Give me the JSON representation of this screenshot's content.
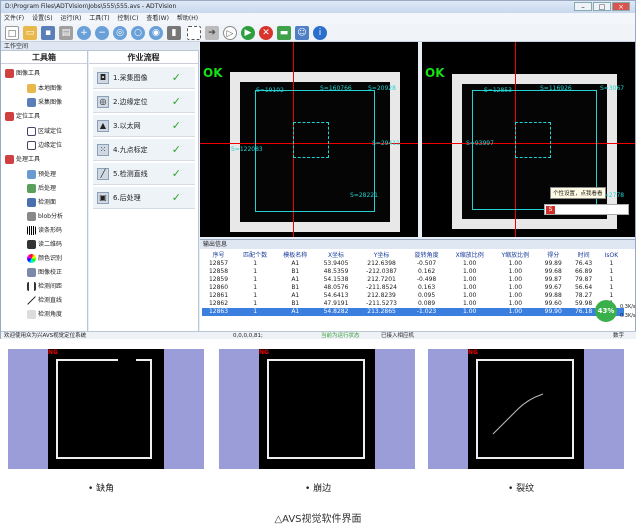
{
  "window": {
    "title": "D:\\Program Files\\ADTVision\\Jobs\\555\\555.avs - ADTVision"
  },
  "menu": [
    "文件(F)",
    "设置(S)",
    "运行(R)",
    "工具(T)",
    "控制(C)",
    "查看(W)",
    "帮助(H)"
  ],
  "panel_title": "工作空间",
  "toolbox": {
    "title": "工具箱",
    "items": [
      {
        "label": "图像工具",
        "level": 0
      },
      {
        "label": "本地图像",
        "level": 1
      },
      {
        "label": "采集图像",
        "level": 1
      },
      {
        "label": "定位工具",
        "level": 0
      },
      {
        "label": "区域定位",
        "level": 1
      },
      {
        "label": "边缘定位",
        "level": 1
      },
      {
        "label": "处理工具",
        "level": 0
      },
      {
        "label": "预处理",
        "level": 1
      },
      {
        "label": "后处理",
        "level": 1
      },
      {
        "label": "检测面",
        "level": 1
      },
      {
        "label": "blob分析",
        "level": 1
      },
      {
        "label": "读条形码",
        "level": 1
      },
      {
        "label": "读二维码",
        "level": 1
      },
      {
        "label": "颜色识别",
        "level": 1
      },
      {
        "label": "图像校正",
        "level": 1
      },
      {
        "label": "检测间距",
        "level": 1
      },
      {
        "label": "检测直线",
        "level": 1
      },
      {
        "label": "检测角度",
        "level": 1
      }
    ]
  },
  "workflow": {
    "title": "作业流程",
    "steps": [
      {
        "label": "1.采集图像",
        "icon": "camera-icon",
        "done": "✓"
      },
      {
        "label": "2.边缘定位",
        "icon": "target-icon",
        "done": "✓"
      },
      {
        "label": "3.以太网",
        "icon": "network-icon",
        "done": "✓"
      },
      {
        "label": "4.九点标定",
        "icon": "grid-icon",
        "done": "✓"
      },
      {
        "label": "5.检测直线",
        "icon": "line-icon",
        "done": "✓"
      },
      {
        "label": "6.后处理",
        "icon": "process-icon",
        "done": "✓"
      }
    ]
  },
  "views": {
    "left": {
      "status": "OK",
      "s_top": "S=19102",
      "s_top2": "S=160766",
      "s_right": "S=20928",
      "s_mid": "S=29411",
      "s_left": "S=122083",
      "s_bot": "S=28221"
    },
    "right": {
      "status": "OK",
      "s_top": "S=12853",
      "s_top2": "S=116926",
      "s_right": "S=3067",
      "s_left": "S=93997",
      "s_right2": "S=2778"
    }
  },
  "tooltip": "个性设置，点我看看",
  "output": {
    "title": "输出信息",
    "columns": [
      "序号",
      "匹配个数",
      "模板名称",
      "X坐标",
      "Y坐标",
      "旋转角度",
      "X缩放比例",
      "Y缩放比例",
      "得分",
      "时间",
      "IsOK"
    ],
    "rows": [
      [
        "12857",
        "1",
        "A1",
        "53.9405",
        "212.6398",
        "-0.507",
        "1.00",
        "1.00",
        "99.89",
        "76.43",
        "1"
      ],
      [
        "12858",
        "1",
        "B1",
        "48.5359",
        "-212.0387",
        "0.162",
        "1.00",
        "1.00",
        "99.68",
        "66.89",
        "1"
      ],
      [
        "12859",
        "1",
        "A1",
        "54.1538",
        "212.7201",
        "-0.498",
        "1.00",
        "1.00",
        "99.87",
        "79.87",
        "1"
      ],
      [
        "12860",
        "1",
        "B1",
        "48.0576",
        "-211.8524",
        "0.163",
        "1.00",
        "1.00",
        "99.67",
        "56.64",
        "1"
      ],
      [
        "12861",
        "1",
        "A1",
        "54.6413",
        "212.8239",
        "0.095",
        "1.00",
        "1.00",
        "99.88",
        "78.27",
        "1"
      ],
      [
        "12862",
        "1",
        "B1",
        "47.9191",
        "-211.5273",
        "0.089",
        "1.00",
        "1.00",
        "99.60",
        "59.98",
        "1"
      ],
      [
        "12863",
        "1",
        "A1",
        "54.8282",
        "213.2865",
        "-1.023",
        "1.00",
        "1.00",
        "99.90",
        "76.18",
        "1"
      ]
    ],
    "selected_index": 6
  },
  "net": {
    "percent": "43%",
    "up": "0.3K/s",
    "down": "0.3K/s"
  },
  "status": {
    "left": "欢迎使用众为兴AVS视觉定位系统",
    "coords": "0,0,0,0,81;",
    "mode": "当前为运行状态",
    "connection": "已接入相应机",
    "right": "数字"
  },
  "thumbnails": [
    {
      "tag": "NG",
      "label": "缺角"
    },
    {
      "tag": "NG",
      "label": "崩边"
    },
    {
      "tag": "NG",
      "label": "裂纹"
    }
  ],
  "caption": "△AVS视觉软件界面",
  "colors": {
    "ok": "#16e016",
    "selected_row": "#3a7ee0",
    "thumb_bg": "#9a9dd8",
    "cyan": "#25d2d2"
  }
}
